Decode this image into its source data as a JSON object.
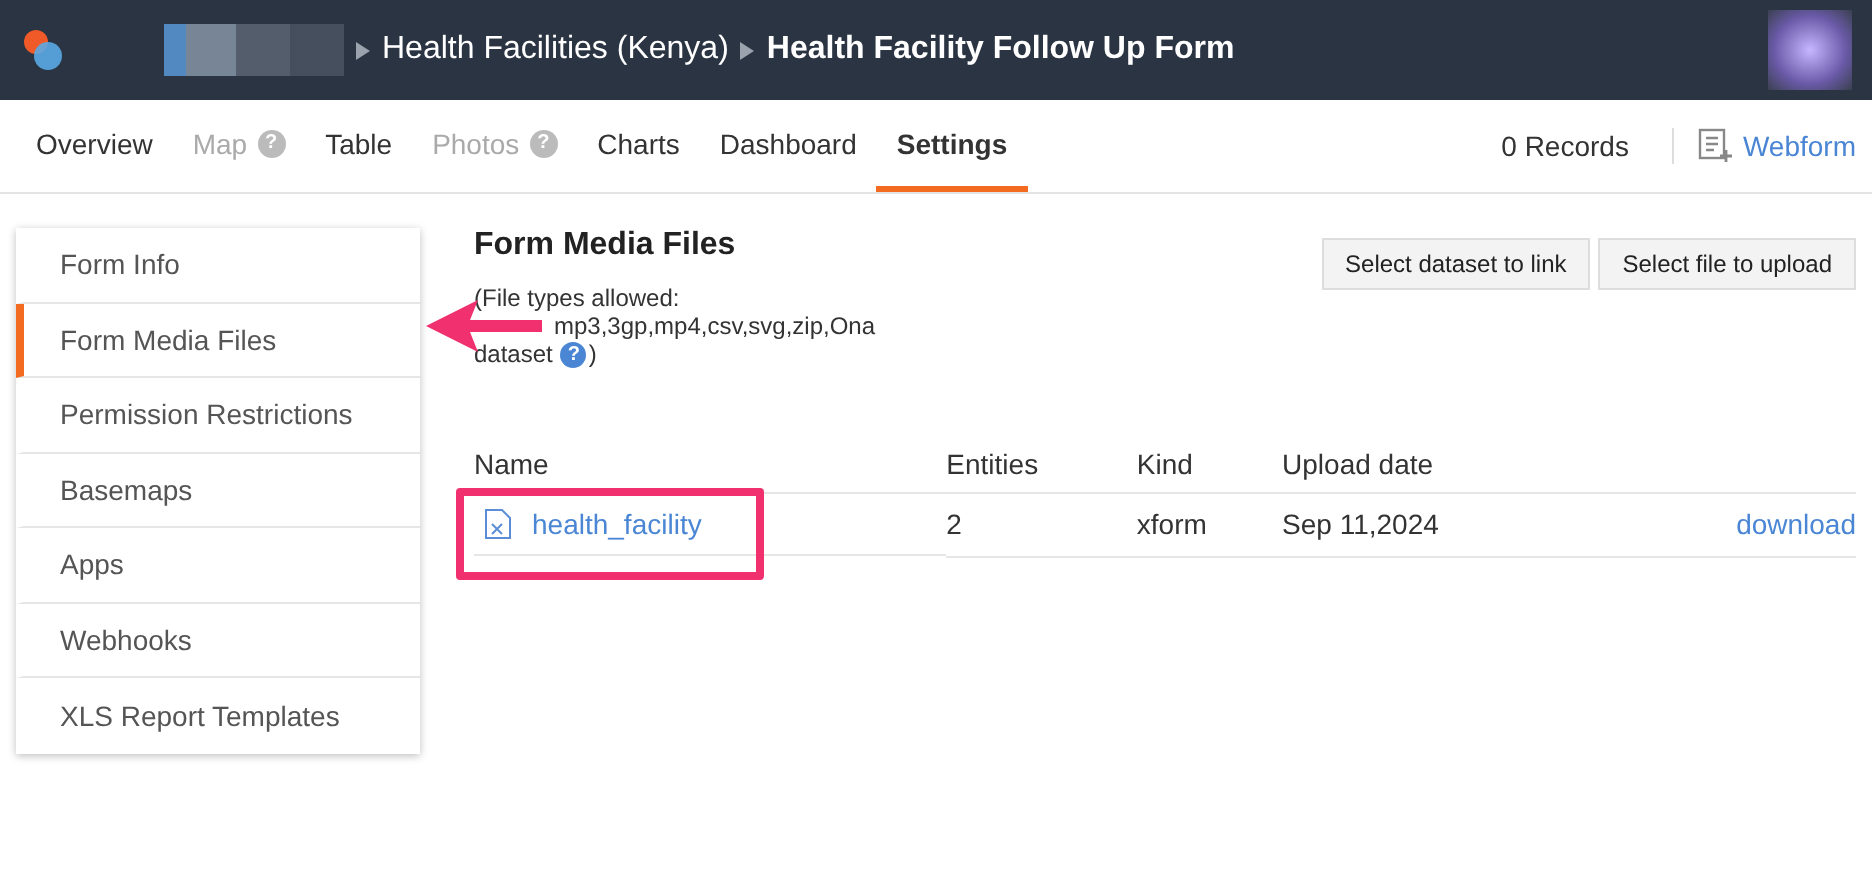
{
  "header": {
    "breadcrumb": [
      "Health Facilities (Kenya)",
      "Health Facility Follow Up Form"
    ]
  },
  "tabs": [
    {
      "label": "Overview",
      "selected": false,
      "disabled": false
    },
    {
      "label": "Map",
      "selected": false,
      "disabled": true,
      "help_icon": "?"
    },
    {
      "label": "Table",
      "selected": false,
      "disabled": false
    },
    {
      "label": "Photos",
      "selected": false,
      "disabled": true,
      "help_icon": "?"
    },
    {
      "label": "Charts",
      "selected": false,
      "disabled": false
    },
    {
      "label": "Dashboard",
      "selected": false,
      "disabled": false
    },
    {
      "label": "Settings",
      "selected": true,
      "disabled": false
    }
  ],
  "records": "0 Records",
  "webform": "Webform",
  "sidebar": {
    "items": [
      {
        "label": "Form Info",
        "selected": false
      },
      {
        "label": "Form Media Files",
        "selected": true
      },
      {
        "label": "Permission Restrictions",
        "selected": false
      },
      {
        "label": "Basemaps",
        "selected": false
      },
      {
        "label": "Apps",
        "selected": false
      },
      {
        "label": "Webhooks",
        "selected": false
      },
      {
        "label": "XLS Report Templates",
        "selected": false
      }
    ]
  },
  "content": {
    "title": "Form Media Files",
    "buttons": [
      "Select dataset to link",
      "Select file to upload"
    ],
    "file_types": [
      "(File types allowed:",
      "mp3,3gp,mp4,csv,svg,zip,Ona",
      "dataset",
      ")"
    ],
    "file_types_help": "?",
    "table": {
      "columns": [
        "Name",
        "Entities",
        "Kind",
        "Upload date"
      ],
      "rows": [
        {
          "name": "health_facility",
          "entities": "2",
          "kind": "xform",
          "upload_date": "Sep 11,2024",
          "action": "download"
        }
      ]
    }
  }
}
